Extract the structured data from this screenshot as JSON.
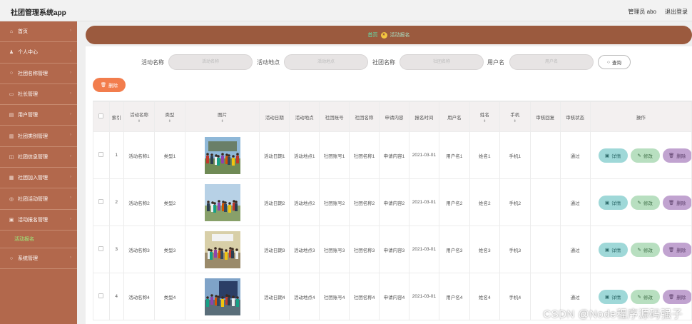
{
  "header": {
    "app_title": "社团管理系统app",
    "admin_label": "管理员 abo",
    "logout": "退出登录"
  },
  "sidebar": {
    "items": [
      {
        "label": "首页",
        "icon": "home-icon",
        "glyph": "⌂"
      },
      {
        "label": "个人中心",
        "icon": "user-icon",
        "glyph": "♟"
      },
      {
        "label": "社团名称管理",
        "icon": "circle-icon",
        "glyph": "○"
      },
      {
        "label": "社长管理",
        "icon": "id-card-icon",
        "glyph": "▭"
      },
      {
        "label": "用户管理",
        "icon": "users-icon",
        "glyph": "▤"
      },
      {
        "label": "社团类别管理",
        "icon": "category-icon",
        "glyph": "▥"
      },
      {
        "label": "社团信息管理",
        "icon": "info-icon",
        "glyph": "◫"
      },
      {
        "label": "社团加入管理",
        "icon": "join-icon",
        "glyph": "▦"
      },
      {
        "label": "社团活动管理",
        "icon": "activity-icon",
        "glyph": "◎"
      },
      {
        "label": "活动报名管理",
        "icon": "signup-icon",
        "glyph": "▣"
      },
      {
        "label": "系统管理",
        "icon": "system-icon",
        "glyph": "○"
      }
    ],
    "sub_item": "活动报名"
  },
  "breadcrumb": {
    "home": "首页",
    "current": "活动报名"
  },
  "search": {
    "fields": [
      {
        "label": "活动名称",
        "placeholder": "活动名称"
      },
      {
        "label": "活动地点",
        "placeholder": "活动地点"
      },
      {
        "label": "社团名称",
        "placeholder": "社团名称"
      },
      {
        "label": "用户名",
        "placeholder": "用户名"
      }
    ],
    "button": "查询"
  },
  "delete_button": "删除",
  "table": {
    "columns": [
      "索引",
      "活动名称",
      "类型",
      "图片",
      "活动日期",
      "活动地点",
      "社团账号",
      "社团名称",
      "申请内容",
      "报名时间",
      "用户名",
      "姓名",
      "手机",
      "审核回复",
      "审核状态",
      "操作"
    ],
    "rows": [
      {
        "index": "1",
        "name": "活动名称1",
        "type": "类型1",
        "date": "活动日期1",
        "place": "活动地点1",
        "club_account": "社团账号1",
        "club_name": "社团名称1",
        "apply": "申请内容1",
        "time": "2021-03-01",
        "username": "用户名1",
        "realname": "姓名1",
        "phone": "手机1",
        "reply": "",
        "status": "通过"
      },
      {
        "index": "2",
        "name": "活动名称2",
        "type": "类型2",
        "date": "活动日期2",
        "place": "活动地点2",
        "club_account": "社团账号2",
        "club_name": "社团名称2",
        "apply": "申请内容2",
        "time": "2021-03-01",
        "username": "用户名2",
        "realname": "姓名2",
        "phone": "手机2",
        "reply": "",
        "status": "通过"
      },
      {
        "index": "3",
        "name": "活动名称3",
        "type": "类型3",
        "date": "活动日期3",
        "place": "活动地点3",
        "club_account": "社团账号3",
        "club_name": "社团名称3",
        "apply": "申请内容3",
        "time": "2021-03-01",
        "username": "用户名3",
        "realname": "姓名3",
        "phone": "手机3",
        "reply": "",
        "status": "通过"
      },
      {
        "index": "4",
        "name": "活动名称4",
        "type": "类型4",
        "date": "活动日期4",
        "place": "活动地点4",
        "club_account": "社团账号4",
        "club_name": "社团名称4",
        "apply": "申请内容4",
        "time": "2021-03-01",
        "username": "用户名4",
        "realname": "姓名4",
        "phone": "手机4",
        "reply": "",
        "status": "通过"
      }
    ],
    "actions": {
      "detail": "详情",
      "edit": "修改",
      "delete": "删除"
    }
  },
  "watermark": "CSDN @Node程序源码强子",
  "colors": {
    "sidebar": "#b2684c",
    "breadcrumb_bar": "#9b5a3e",
    "delete_button": "#f27d4d",
    "detail": "#9fd8d8",
    "edit": "#b8dfc0",
    "remove": "#c1a3d0",
    "sub_item": "#9bf07d"
  }
}
